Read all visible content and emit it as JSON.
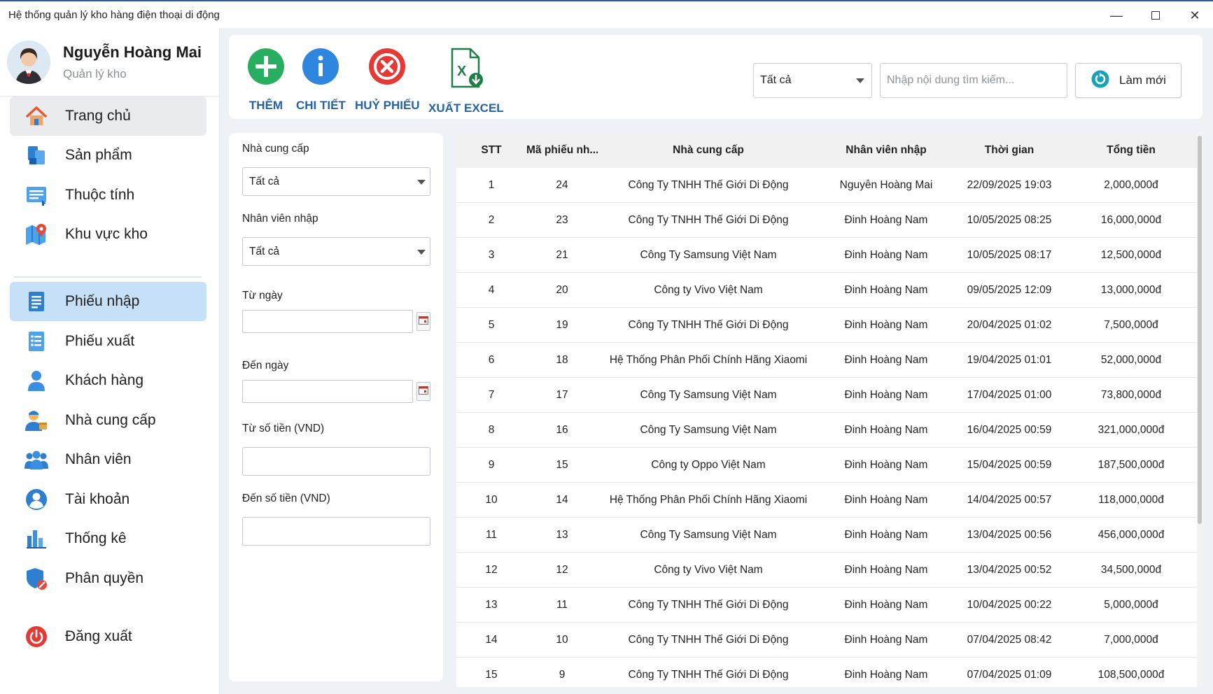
{
  "window": {
    "title": "Hệ thống quản lý kho hàng điện thoại di động"
  },
  "user": {
    "name": "Nguyễn Hoàng Mai",
    "role": "Quản lý kho"
  },
  "sidebar": {
    "items": [
      {
        "label": "Trang chủ",
        "icon": "home-icon"
      },
      {
        "label": "Sản phẩm",
        "icon": "products-icon"
      },
      {
        "label": "Thuộc tính",
        "icon": "attributes-icon"
      },
      {
        "label": "Khu vực kho",
        "icon": "warehouse-location-icon"
      },
      {
        "label": "Phiếu nhập",
        "icon": "import-receipt-icon",
        "active": true
      },
      {
        "label": "Phiếu xuất",
        "icon": "export-receipt-icon"
      },
      {
        "label": "Khách hàng",
        "icon": "customer-icon"
      },
      {
        "label": "Nhà cung cấp",
        "icon": "supplier-icon"
      },
      {
        "label": "Nhân viên",
        "icon": "staff-icon"
      },
      {
        "label": "Tài khoản",
        "icon": "account-icon"
      },
      {
        "label": "Thống kê",
        "icon": "statistics-icon"
      },
      {
        "label": "Phân quyền",
        "icon": "permission-icon"
      }
    ],
    "logout": "Đăng xuất"
  },
  "toolbar": {
    "add": "THÊM",
    "detail": "CHI TIẾT",
    "cancel": "HUỶ PHIẾU",
    "export_excel": "XUẤT EXCEL",
    "filter_value": "Tất cả",
    "search_placeholder": "Nhập nội dung tìm kiếm...",
    "refresh": "Làm mới"
  },
  "filters": {
    "supplier_label": "Nhà cung cấp",
    "supplier_value": "Tất cả",
    "employee_label": "Nhân viên nhập",
    "employee_value": "Tất cả",
    "from_date_label": "Từ ngày",
    "to_date_label": "Đến ngày",
    "from_amount_label": "Từ số tiền (VND)",
    "to_amount_label": "Đến số tiền (VND)"
  },
  "table": {
    "headers": [
      "STT",
      "Mã phiếu nh...",
      "Nhà cung cấp",
      "Nhân viên nhập",
      "Thời gian",
      "Tổng tiền"
    ],
    "rows": [
      [
        "1",
        "24",
        "Công Ty TNHH Thế Giới Di Động",
        "Nguyễn Hoàng Mai",
        "22/09/2025 19:03",
        "2,000,000đ"
      ],
      [
        "2",
        "23",
        "Công Ty TNHH Thế Giới Di Động",
        "Đinh Hoàng Nam",
        "10/05/2025 08:25",
        "16,000,000đ"
      ],
      [
        "3",
        "21",
        "Công Ty Samsung Việt Nam",
        "Đinh Hoàng Nam",
        "10/05/2025 08:17",
        "12,500,000đ"
      ],
      [
        "4",
        "20",
        "Công ty Vivo Việt Nam",
        "Đinh Hoàng Nam",
        "09/05/2025 12:09",
        "13,000,000đ"
      ],
      [
        "5",
        "19",
        "Công Ty TNHH Thế Giới Di Động",
        "Đinh Hoàng Nam",
        "20/04/2025 01:02",
        "7,500,000đ"
      ],
      [
        "6",
        "18",
        "Hệ Thống Phân Phối Chính Hãng Xiaomi",
        "Đinh Hoàng Nam",
        "19/04/2025 01:01",
        "52,000,000đ"
      ],
      [
        "7",
        "17",
        "Công Ty Samsung Việt Nam",
        "Đinh Hoàng Nam",
        "17/04/2025 01:00",
        "73,800,000đ"
      ],
      [
        "8",
        "16",
        "Công Ty Samsung Việt Nam",
        "Đinh Hoàng Nam",
        "16/04/2025 00:59",
        "321,000,000đ"
      ],
      [
        "9",
        "15",
        "Công ty Oppo Việt Nam",
        "Đinh Hoàng Nam",
        "15/04/2025 00:59",
        "187,500,000đ"
      ],
      [
        "10",
        "14",
        "Hệ Thống Phân Phối Chính Hãng Xiaomi",
        "Đinh Hoàng Nam",
        "14/04/2025 00:57",
        "118,000,000đ"
      ],
      [
        "11",
        "13",
        "Công Ty Samsung Việt Nam",
        "Đinh Hoàng Nam",
        "13/04/2025 00:56",
        "456,000,000đ"
      ],
      [
        "12",
        "12",
        "Công ty Vivo Việt Nam",
        "Đinh Hoàng Nam",
        "13/04/2025 00:52",
        "34,500,000đ"
      ],
      [
        "13",
        "11",
        "Công Ty TNHH Thế Giới Di Động",
        "Đinh Hoàng Nam",
        "10/04/2025 00:22",
        "5,000,000đ"
      ],
      [
        "14",
        "10",
        "Công Ty TNHH Thế Giới Di Động",
        "Đinh Hoàng Nam",
        "07/04/2025 08:42",
        "7,000,000đ"
      ],
      [
        "15",
        "9",
        "Công Ty TNHH Thế Giới Di Động",
        "Đinh Hoàng Nam",
        "07/04/2025 01:09",
        "108,500,000đ"
      ]
    ]
  },
  "colors": {
    "accent": "#2462a8",
    "active_menu": "#c5e0f7",
    "add_green": "#27ae60",
    "detail_blue": "#2e86de",
    "cancel_red": "#e53935",
    "excel_green": "#1e7e45"
  }
}
